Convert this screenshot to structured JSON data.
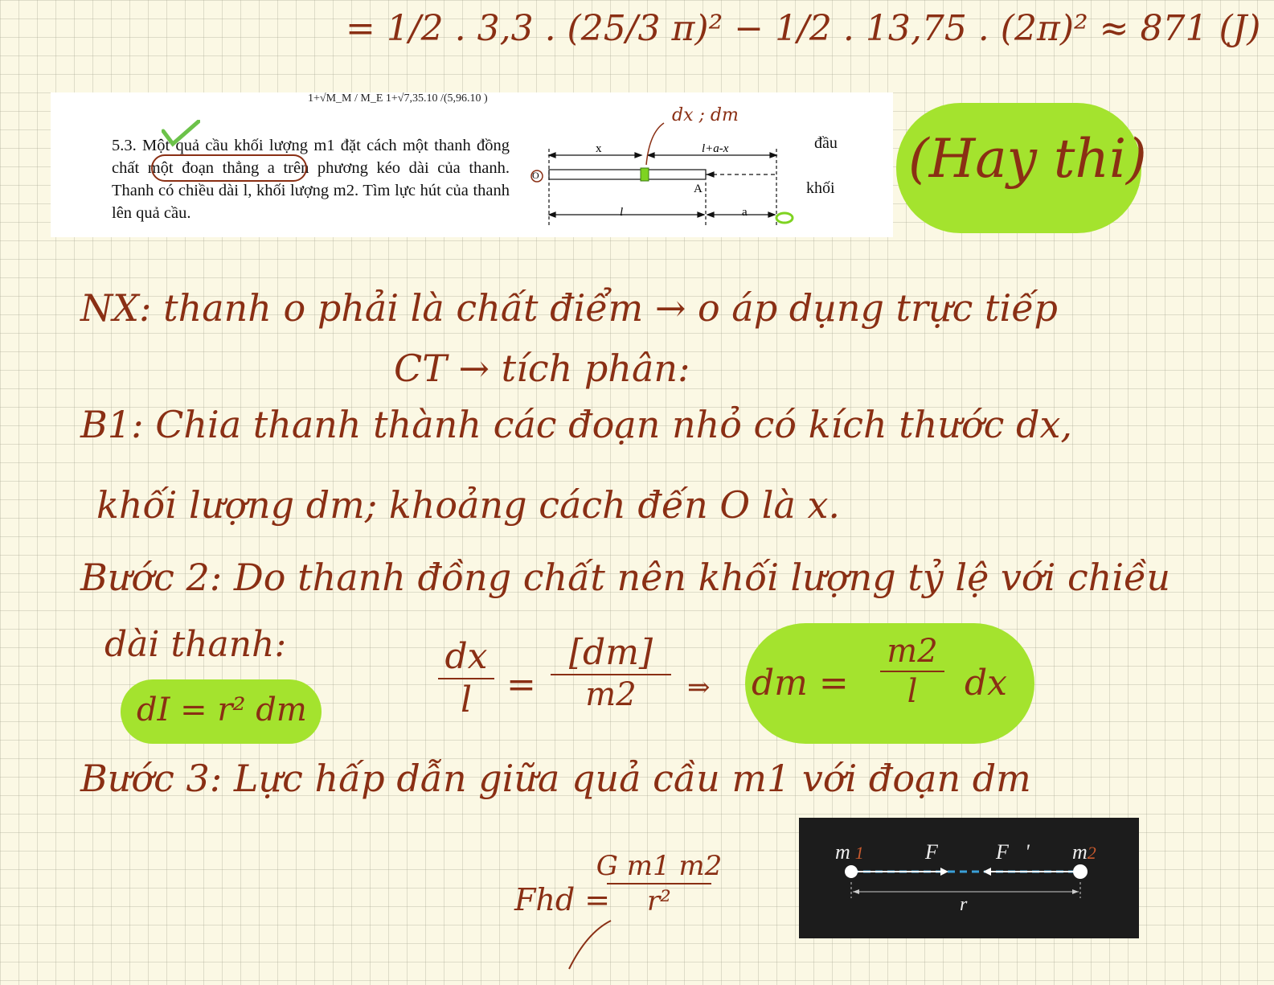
{
  "top_equation": "= 1/2 . 3,3 . (25/3 π)² − 1/2 . 13,75 . (2π)² ≈ 871 (J)",
  "problem": {
    "cutoff_line": "1+√M_M / M_E     1+√7,35.10   /(5,96.10  )",
    "number": "5.3.",
    "text": "Một quả cầu khối lượng m1 đặt cách một thanh đồng chất một đoạn thẳng a trên phương kéo dài của thanh. Thanh có chiều dài l, khối lượng m2. Tìm lực hút của thanh lên quả cầu.",
    "side_word_1": "đầu",
    "side_word_2": "khối",
    "figure": {
      "handwritten_label": "dx ; dm",
      "label_x": "x",
      "label_l_a_x": "l+a-x",
      "label_O": "O",
      "label_A": "A",
      "label_l": "l",
      "label_a": "a"
    }
  },
  "hay_thi_note": "(Hay thi)",
  "notes": {
    "nx_line1": "NX: thanh o phải là chất điểm → o áp dụng trực tiếp",
    "nx_line2": "CT → tích phân:",
    "b1_line1": "B1: Chia thanh thành các đoạn nhỏ có kích thước dx,",
    "b1_line2": "khối lượng dm; khoảng cách đến O là x.",
    "b2_line1": "Bước 2: Do thanh đồng chất nên khối lượng tỷ lệ với chiều",
    "b2_line2": "dài thanh:",
    "di_eq": "dI = r² dm",
    "ratio_lhs_num": "dx",
    "ratio_lhs_den": "l",
    "ratio_eq": "=",
    "ratio_rhs_num": "[dm]",
    "ratio_rhs_den": "m2",
    "implies": "⇒",
    "dm_lhs": "dm =",
    "dm_num": "m2",
    "dm_den": "l",
    "dm_tail": "dx",
    "b3_line": "Bước 3: Lực hấp dẫn giữa quả cầu m1 với đoạn dm",
    "fhd_lhs": "Fhd =",
    "fhd_num": "G m1 m2",
    "fhd_den": "r²"
  },
  "blackboard": {
    "m1": "m",
    "m1_sub": "1",
    "F": "F⃗",
    "F_prime": "F⃗'",
    "m2": "m",
    "m2_sub": "2",
    "r": "r"
  },
  "colors": {
    "ink": "#8a2f14",
    "highlight": "#a4e32e",
    "paper": "#fbf8e4",
    "board": "#1c1c1c",
    "board_line": "#3aa0d8"
  }
}
